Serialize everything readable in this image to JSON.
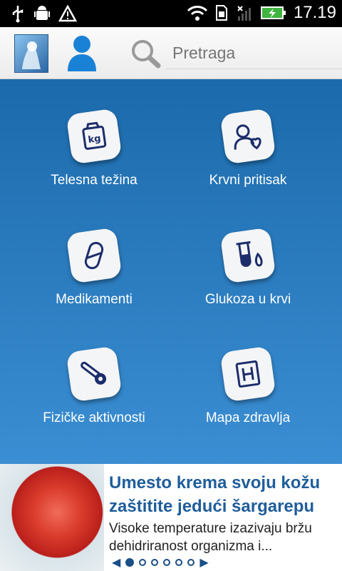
{
  "status": {
    "time": "17.19"
  },
  "header": {
    "search_placeholder": "Pretraga"
  },
  "tiles": [
    {
      "label": "Telesna težina",
      "icon": "weight-icon"
    },
    {
      "label": "Krvni pritisak",
      "icon": "blood-pressure-icon"
    },
    {
      "label": "Medikamenti",
      "icon": "pill-icon"
    },
    {
      "label": "Glukoza u krvi",
      "icon": "glucose-icon"
    },
    {
      "label": "Fizičke aktivnosti",
      "icon": "thermometer-icon"
    },
    {
      "label": "Mapa zdravlja",
      "icon": "hospital-icon"
    }
  ],
  "news": {
    "title": "Umesto krema svoju kožu zaštitite jedući šargarepu",
    "snippet": "Visoke temperature izazivaju bržu dehidriranost organizma i..."
  },
  "colors": {
    "primary": "#1d6fb2",
    "title": "#1f5d9b"
  }
}
